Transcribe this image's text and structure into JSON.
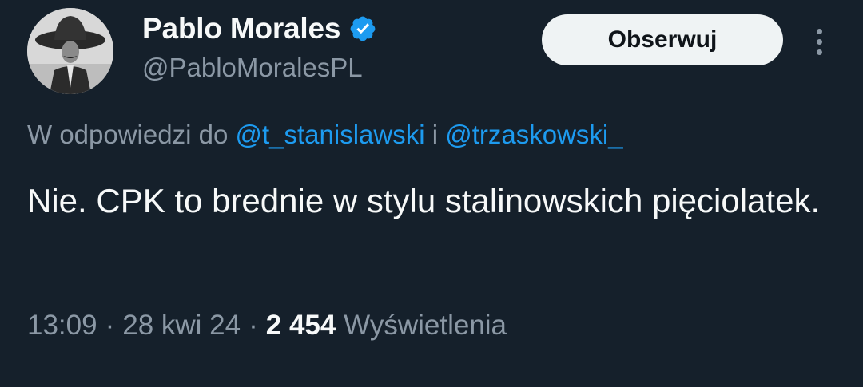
{
  "author": {
    "display_name": "Pablo Morales",
    "handle": "@PabloMoralesPL",
    "verified_icon": "verified-badge-icon",
    "avatar_description_icon": "avatar"
  },
  "actions": {
    "follow_label": "Obserwuj",
    "more_icon": "more-vertical-icon"
  },
  "reply": {
    "prefix": "W odpowiedzi do ",
    "mention_1": "@t_stanislawski",
    "conjunction": " i ",
    "mention_2": "@trzaskowski_"
  },
  "tweet": {
    "text": "Nie. CPK to brednie w stylu stalinowskich pięciolatek."
  },
  "meta": {
    "time": "13:09",
    "separator": "·",
    "date": "28 kwi 24",
    "views_count": "2 454",
    "views_label": "Wyświetlenia"
  },
  "colors": {
    "background": "#15202b",
    "accent_link": "#1d9bf0",
    "secondary_text": "#8b98a5",
    "primary_text": "#f7f9f9",
    "follow_button_bg": "#eff3f4"
  }
}
